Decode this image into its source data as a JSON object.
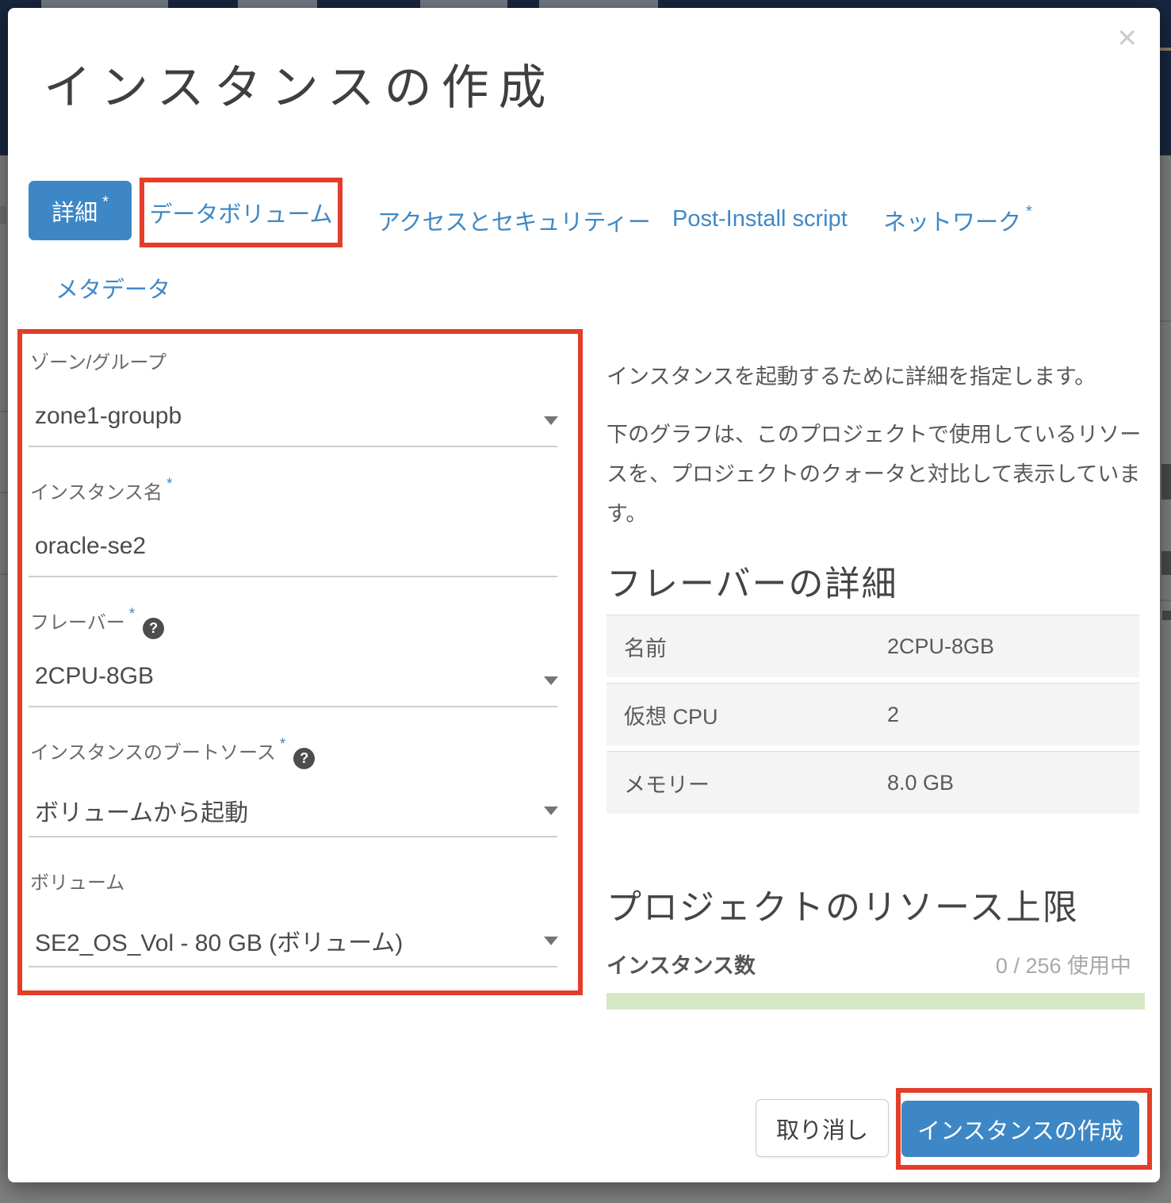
{
  "modal": {
    "title": "インスタンスの作成",
    "close_icon": "✕",
    "required_marker": "*",
    "help_glyph": "?",
    "tabs": [
      {
        "label": "詳細",
        "required": true,
        "active": true
      },
      {
        "label": "データボリューム",
        "required": false,
        "highlighted": true
      },
      {
        "label": "アクセスとセキュリティー",
        "required": false
      },
      {
        "label": "Post-Install script",
        "required": false
      },
      {
        "label": "ネットワーク",
        "required": true
      },
      {
        "label": "メタデータ",
        "required": false
      }
    ],
    "form": {
      "fields": [
        {
          "label": "ゾーン/グループ",
          "value": "zone1-groupb",
          "control": "select",
          "required": false,
          "help": false
        },
        {
          "label": "インスタンス名",
          "value": "oracle-se2",
          "control": "text",
          "required": true,
          "help": false
        },
        {
          "label": "フレーバー",
          "value": "2CPU-8GB",
          "control": "select",
          "required": true,
          "help": true
        },
        {
          "label": "インスタンスのブートソース",
          "value": "ボリュームから起動",
          "control": "select",
          "required": true,
          "help": true
        },
        {
          "label": "ボリューム",
          "value": "SE2_OS_Vol - 80 GB (ボリューム)",
          "control": "select",
          "required": false,
          "help": false
        }
      ]
    },
    "help_panel": {
      "intro": "インスタンスを起動するために詳細を指定します。",
      "description": "下のグラフは、このプロジェクトで使用しているリソースを、プロジェクトのクォータと対比して表示しています。",
      "flavor_details": {
        "heading": "フレーバーの詳細",
        "rows": [
          {
            "label": "名前",
            "value": "2CPU-8GB"
          },
          {
            "label": "仮想 CPU",
            "value": "2"
          },
          {
            "label": "メモリー",
            "value": "8.0 GB"
          }
        ]
      },
      "project_limits": {
        "heading": "プロジェクトのリソース上限",
        "quota_label": "インスタンス数",
        "quota_usage_text": "0 / 256 使用中",
        "instances_used": 0,
        "instances_limit": 256
      }
    },
    "footer": {
      "cancel_label": "取り消し",
      "submit_label": "インスタンスの作成"
    }
  },
  "colors": {
    "accent_blue": "#3d87c6",
    "annotation_red": "#e33e29",
    "progress_green": "#d5e8c4",
    "navbar_navy": "#18263f"
  }
}
